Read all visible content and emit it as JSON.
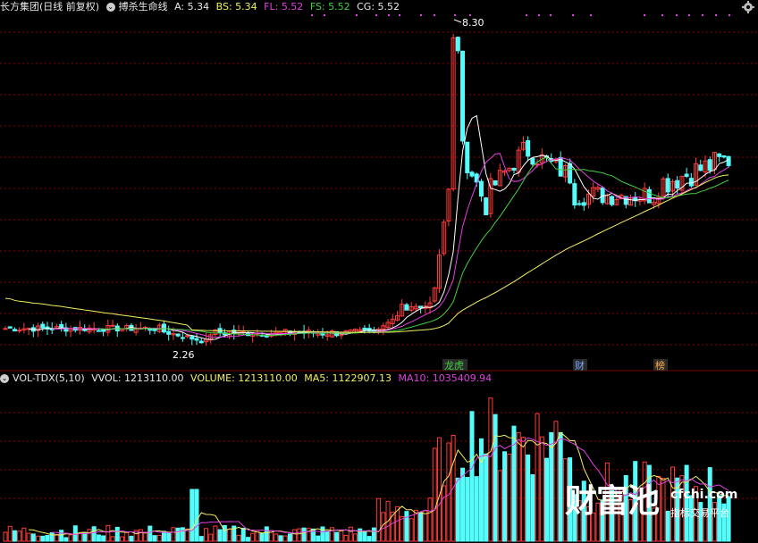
{
  "header": {
    "stock": "长方集团(日线 前复权)",
    "indicator": "搏杀生命线",
    "a_label": "A: 5.34",
    "bs_label": "BS: 5.34",
    "fl_label": "FL: 5.52",
    "fs_label": "FS: 5.52",
    "cg_label": "CG: 5.52"
  },
  "annotations": {
    "high": "8.30",
    "low": "2.26"
  },
  "tags": [
    "龙虎",
    "财",
    "榜"
  ],
  "volume_header": {
    "indicator": "VOL-TDX(5,10)",
    "vvol": "VVOL: 1213110.00",
    "volume": "VOLUME: 1213110.00",
    "ma5": "MA5: 1122907.13",
    "ma10": "MA10: 1035409.94"
  },
  "watermark": {
    "brand": "财富池",
    "site": "cfchi.com",
    "slogan": "指标交易平台"
  },
  "colors": {
    "up": "#ff3b3b",
    "down": "#54fcfc",
    "grid": "#8b0000",
    "yellow": "#f0f060",
    "magenta": "#e040e0",
    "green": "#40d040",
    "white": "#ffffff"
  }
}
